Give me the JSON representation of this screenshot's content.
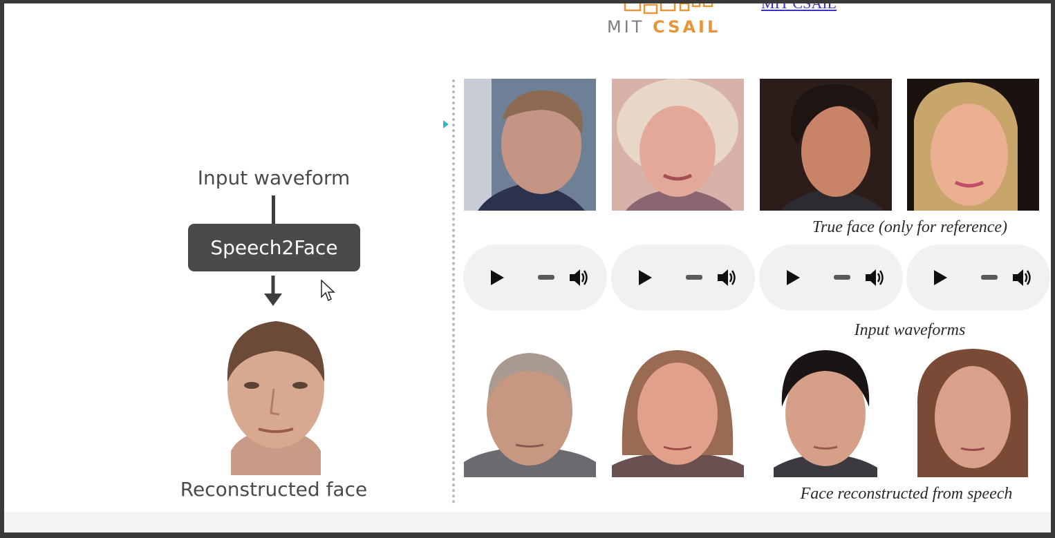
{
  "header": {
    "logo_mit": "MIT",
    "logo_csail": "CSAIL",
    "link_text": "MIT CSAIL",
    "accent_color": "#e8953a",
    "link_color": "#3a31c9"
  },
  "diagram": {
    "input_label": "Input waveform",
    "model_label": "Speech2Face",
    "output_label": "Reconstructed face",
    "waveform_color": "#1b9bb6",
    "box_color": "#4a4a4a"
  },
  "examples": {
    "true_caption": "True face (only for reference)",
    "waveforms_caption": "Input waveforms",
    "reconstructed_caption": "Face reconstructed from speech",
    "players": [
      {
        "play_icon": "play-icon",
        "volume_icon": "volume-icon"
      },
      {
        "play_icon": "play-icon",
        "volume_icon": "volume-icon"
      },
      {
        "play_icon": "play-icon",
        "volume_icon": "volume-icon"
      },
      {
        "play_icon": "play-icon",
        "volume_icon": "volume-icon"
      }
    ]
  }
}
